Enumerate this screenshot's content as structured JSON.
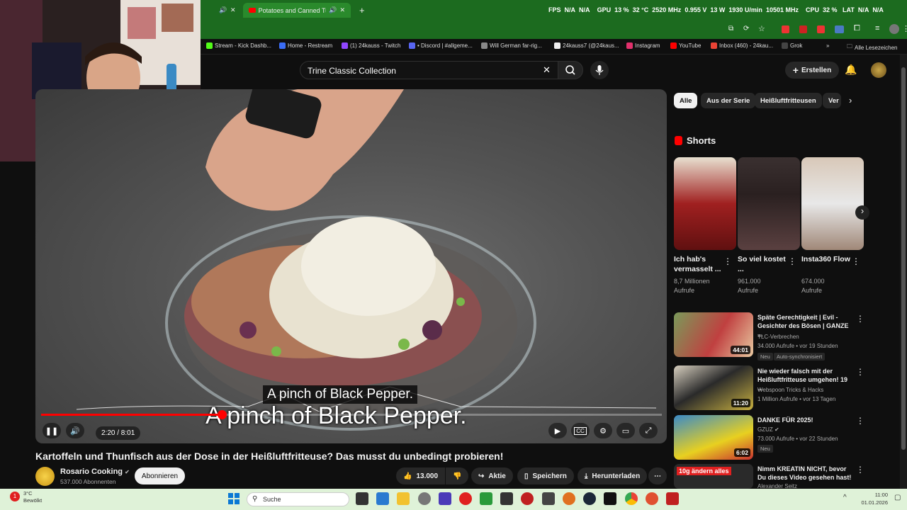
{
  "browser": {
    "tab_active": "Potatoes and Canned Tuna",
    "hud": {
      "fps_label": "FPS",
      "fps_value": "N/A",
      "fps_value2": "N/A",
      "gpu_label": "GPU",
      "gpu_util": "13 %",
      "gpu_temp": "32 °C",
      "gpu_clock": "2520 MHz",
      "gpu_volt": "0.955 V",
      "gpu_power": "13 W",
      "gpu_fan": "1930 U/min",
      "gpu_mem": "10501 MHz",
      "cpu_label": "CPU",
      "cpu_util": "32 %",
      "lat_label": "LAT",
      "lat_value": "N/A",
      "lat_value2": "N/A"
    },
    "bookmarks": [
      {
        "label": "Stream - Kick Dashb...",
        "color": "#53fc18"
      },
      {
        "label": "Home - Restream",
        "color": "#3a6cf4"
      },
      {
        "label": "(1) 24kauss - Twitch",
        "color": "#9146ff"
      },
      {
        "label": "• Discord | #allgeme...",
        "color": "#5865f2"
      },
      {
        "label": "Will German far-rig...",
        "color": "#888888"
      },
      {
        "label": "24kauss7 (@24kaus...",
        "color": "#111111"
      },
      {
        "label": "Instagram",
        "color": "#e1306c"
      },
      {
        "label": "YouTube",
        "color": "#ff0000"
      },
      {
        "label": "Inbox (460) - 24kau...",
        "color": "#ea4335"
      },
      {
        "label": "Grok",
        "color": "#444444"
      }
    ],
    "bookmarks_all": "Alle Lesezeichen"
  },
  "header": {
    "search_value": "Trine Classic Collection",
    "create_label": "Erstellen"
  },
  "player": {
    "caption_small": "A pinch of Black Pepper.",
    "caption_big": "A pinch of Black Pepper.",
    "time": "2:20 / 8:01",
    "progress": 0.291
  },
  "video": {
    "title": "Kartoffeln und Thunfisch aus der Dose in der Heißluftfritteuse? Das musst du unbedingt probieren!",
    "channel": "Rosario Cooking",
    "subscribers": "537.000 Abonnenten",
    "subscribe_label": "Abonnieren",
    "likes": "13.000",
    "share_label": "Aktie",
    "save_label": "Speichern",
    "download_label": "Herunterladen"
  },
  "chips": [
    "Alle",
    "Aus der Serie",
    "Heißluftfritteusen",
    "Ver"
  ],
  "shorts": {
    "heading": "Shorts",
    "items": [
      {
        "title": "Ich hab's vermasselt ...",
        "views": "8,7 Millionen Aufrufe"
      },
      {
        "title": "So viel kostet ...",
        "views": "961.000 Aufrufe"
      },
      {
        "title": "Insta360 Flow",
        "views": "674.000 Aufrufe"
      }
    ]
  },
  "recommendations": [
    {
      "title": "Späte Gerechtigkeit | Evil - Gesichter des Bösen | GANZE ...",
      "channel": "TLC-Verbrechen",
      "meta": "34.000 Aufrufe • vor 19 Stunden",
      "duration": "44:01",
      "badges": [
        "Neu",
        "Auto-synchronisiert"
      ]
    },
    {
      "title": "Nie wieder falsch mit der Heißluftfritteuse umgehen! 19 ...",
      "channel": "Webspoon Tricks & Hacks",
      "meta": "1 Million Aufrufe • vor 13 Tagen",
      "duration": "11:20",
      "badges": []
    },
    {
      "title": "DANKE FÜR 2025!",
      "channel": "GZUZ",
      "meta": "73.000 Aufrufe • vor 22 Stunden",
      "duration": "6:02",
      "badges": [
        "Neu"
      ]
    },
    {
      "title": "Nimm KREATIN NICHT, bevor Du dieses Video gesehen hast!",
      "channel": "Alexander Seitz",
      "meta": "",
      "duration": "",
      "thumb_text": "10g ändern alles",
      "badges": []
    }
  ],
  "taskbar": {
    "weather_temp": "3°C",
    "weather_desc": "Bewölkt",
    "search_placeholder": "Suche",
    "time": "11:00",
    "date": "01.01.2026"
  }
}
